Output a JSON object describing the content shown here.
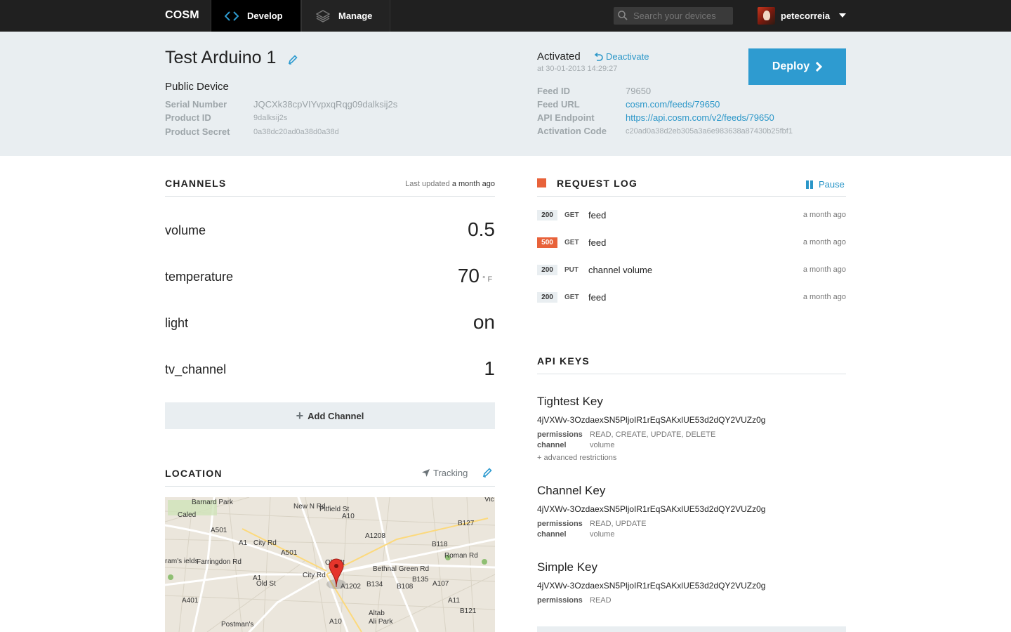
{
  "nav": {
    "brand": "COSM",
    "tabs": [
      {
        "label": "Develop",
        "active": true,
        "icon": "code-brackets-icon"
      },
      {
        "label": "Manage",
        "active": false,
        "icon": "layers-icon"
      }
    ],
    "search_placeholder": "Search your devices",
    "username": "petecorreia"
  },
  "device": {
    "title": "Test Arduino 1",
    "visibility": "Public Device",
    "fields": [
      {
        "label": "Serial Number",
        "value": "JQCXk38cpVIYvpxqRqg09dalksij2s"
      },
      {
        "label": "Product ID",
        "value": "9dalksij2s"
      },
      {
        "label": "Product Secret",
        "value": "0a38dc20ad0a38d0a38d"
      }
    ]
  },
  "activation": {
    "status": "Activated",
    "deactivate_label": "Deactivate",
    "timestamp": "at 30-01-2013 14:29:27",
    "deploy_label": "Deploy",
    "feed_id_label": "Feed ID",
    "feed_id": "79650",
    "feed_url_label": "Feed URL",
    "feed_url": "cosm.com/feeds/79650",
    "api_endpoint_label": "API Endpoint",
    "api_endpoint": "https://api.cosm.com/v2/feeds/79650",
    "activation_code_label": "Activation Code",
    "activation_code": "c20ad0a38d2eb305a3a6e983638a87430b25fbf1"
  },
  "channels": {
    "title": "CHANNELS",
    "last_updated_prefix": "Last updated",
    "last_updated": "a month ago",
    "items": [
      {
        "name": "volume",
        "value": "0.5",
        "unit": ""
      },
      {
        "name": "temperature",
        "value": "70",
        "unit": "° F"
      },
      {
        "name": "light",
        "value": "on",
        "unit": ""
      },
      {
        "name": "tv_channel",
        "value": "1",
        "unit": ""
      }
    ],
    "add_label": "Add Channel"
  },
  "location": {
    "title": "LOCATION",
    "tracking_label": "Tracking",
    "map_labels": {
      "barnard_park": "Barnard Park",
      "a501": "A501",
      "a1": "A1",
      "city_rd": "City Rd",
      "a501b": "A501",
      "new_n_rd": "New N Rd",
      "pitfield_st": "Pitfield St",
      "a10": "A10",
      "a1208": "A1208",
      "b127": "B127",
      "b118": "B118",
      "roman_rd": "Roman Rd",
      "old_st": "Old St",
      "a1b": "A1",
      "old_st2": "Old St",
      "farringdon_rd": "Farringdon Rd",
      "city_rd2": "City Rd",
      "bethnal_green_rd": "Bethnal Green Rd",
      "b135": "B135",
      "b108": "B108",
      "b134": "B134",
      "a1202": "A1202",
      "a107": "A107",
      "a11": "A11",
      "b121": "B121",
      "a401": "A401",
      "postmans": "Postman's",
      "a10b": "A10",
      "altab": "Altab",
      "ali_park": "Ali Park",
      "rams_fields": "ram's\nields",
      "vic": "Vic",
      "caled": "Caled"
    }
  },
  "request_log": {
    "title": "REQUEST LOG",
    "pause_label": "Pause",
    "rows": [
      {
        "status": "200",
        "method": "GET",
        "resource": "feed",
        "time": "a month ago",
        "error": false
      },
      {
        "status": "500",
        "method": "GET",
        "resource": "feed",
        "time": "a month ago",
        "error": true
      },
      {
        "status": "200",
        "method": "PUT",
        "resource": "channel volume",
        "time": "a month ago",
        "error": false
      },
      {
        "status": "200",
        "method": "GET",
        "resource": "feed",
        "time": "a month ago",
        "error": false
      }
    ]
  },
  "api_keys": {
    "title": "API KEYS",
    "permissions_label": "permissions",
    "channel_label": "channel",
    "advanced_label": "+ advanced restrictions",
    "keys": [
      {
        "name": "Tightest Key",
        "token": "4jVXWv-3OzdaexSN5PljoIR1rEqSAKxlUE53d2dQY2VUZz0g",
        "permissions": "READ, CREATE, UPDATE, DELETE",
        "channel": "volume"
      },
      {
        "name": "Channel Key",
        "token": "4jVXWv-3OzdaexSN5PljoIR1rEqSAKxlUE53d2dQY2VUZz0g",
        "permissions": "READ, UPDATE",
        "channel": "volume"
      },
      {
        "name": "Simple Key",
        "token": "4jVXWv-3OzdaexSN5PljoIR1rEqSAKxlUE53d2dQY2VUZz0g",
        "permissions": "READ",
        "channel": ""
      }
    ]
  },
  "colors": {
    "accent": "#2e9bd0",
    "error": "#e8623a",
    "topbar": "#202020",
    "panel": "#e9eef1"
  }
}
